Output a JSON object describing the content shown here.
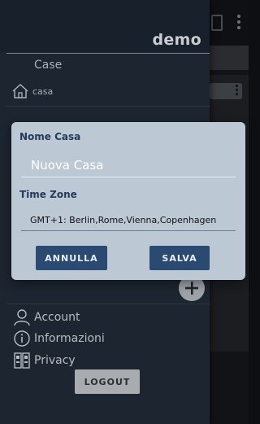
{
  "app": {
    "brand": "demo"
  },
  "drawer": {
    "section_title": "Case",
    "houses": [
      {
        "label": "casa",
        "icon": "home-icon"
      }
    ],
    "add_icon": "plus-icon",
    "menu": [
      {
        "label": "Account",
        "icon": "user-icon"
      },
      {
        "label": "Informazioni",
        "icon": "info-icon"
      },
      {
        "label": "Privacy",
        "icon": "privacy-icon"
      }
    ],
    "logout_label": "LOGOUT"
  },
  "dialog": {
    "name_label": "Nome Casa",
    "name_value": "Nuova Casa",
    "timezone_label": "Time Zone",
    "timezone_value": "GMT+1:  Berlin,Rome,Vienna,Copenhagen",
    "cancel_label": "ANNULLA",
    "save_label": "SALVA"
  },
  "colors": {
    "drawer_bg": "#1d2530",
    "dialog_bg": "#bcc8d4",
    "dialog_label": "#233b5a",
    "button_bg": "#2b4a72"
  }
}
